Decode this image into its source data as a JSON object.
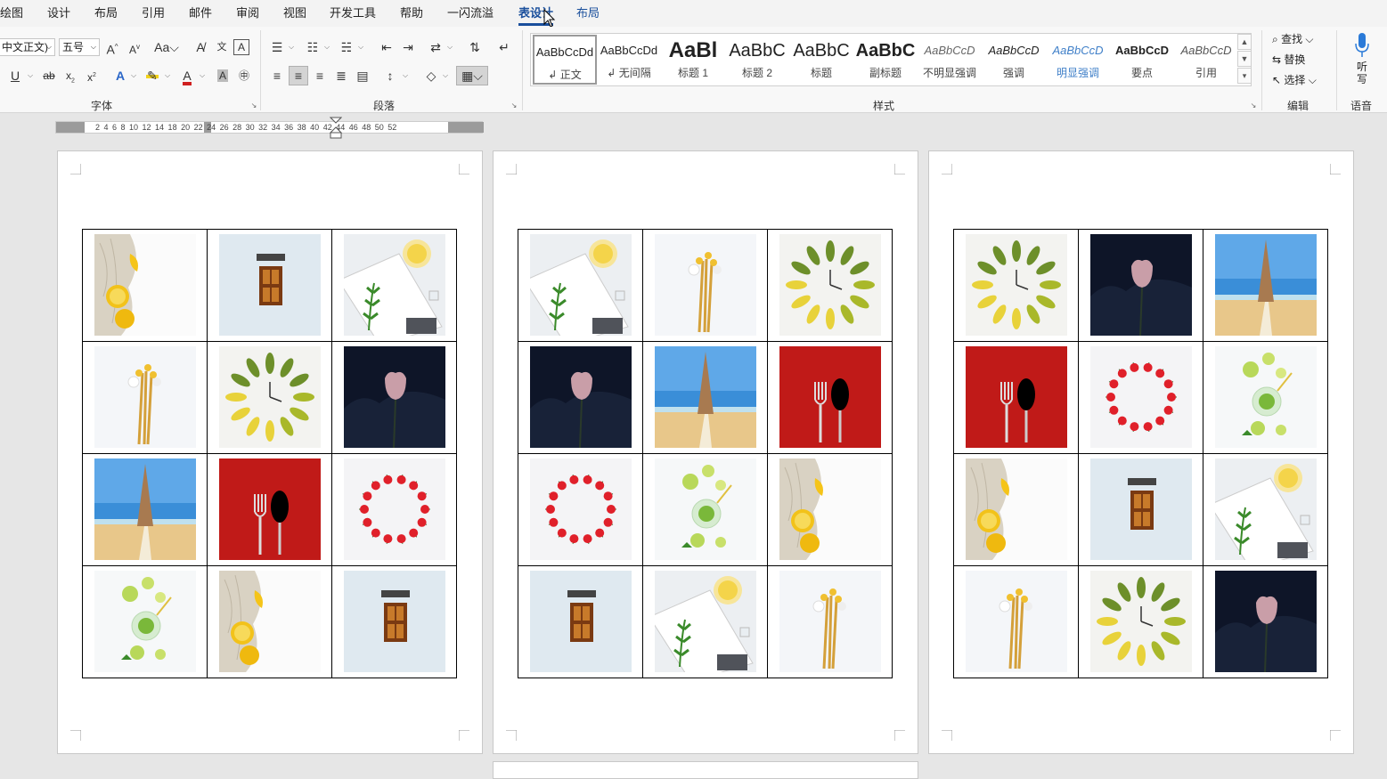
{
  "tabs": [
    "绘图",
    "设计",
    "布局",
    "引用",
    "邮件",
    "审阅",
    "视图",
    "开发工具",
    "帮助",
    "一闪流溢",
    "表设计",
    "布局"
  ],
  "active_tab": "表设计",
  "font_group": {
    "font_name": "中文正文)",
    "font_size": "五号",
    "label": "字体"
  },
  "paragraph_group": {
    "label": "段落"
  },
  "styles_group": {
    "label": "样式",
    "items": [
      {
        "preview": "AaBbCcDd",
        "name": "正文"
      },
      {
        "preview": "AaBbCcDd",
        "name": "无间隔"
      },
      {
        "preview": "AaBl",
        "name": "标题 1"
      },
      {
        "preview": "AaBbC",
        "name": "标题 2"
      },
      {
        "preview": "AaBbC",
        "name": "标题"
      },
      {
        "preview": "AaBbC",
        "name": "副标题"
      },
      {
        "preview": "AaBbCcD",
        "name": "不明显强调"
      },
      {
        "preview": "AaBbCcD",
        "name": "强调"
      },
      {
        "preview": "AaBbCcD",
        "name": "明显强调"
      },
      {
        "preview": "AaBbCcD",
        "name": "要点"
      },
      {
        "preview": "AaBbCcD",
        "name": "引用"
      }
    ]
  },
  "editing_group": {
    "find": "查找",
    "replace": "替换",
    "select": "选择",
    "label": "编辑"
  },
  "voice_group": {
    "dictate": "听写",
    "label": "语音"
  },
  "ruler": {
    "numbers": "2 4 6 8 10 12 14 18 20 22 24 26 28 30 32 34 36 38 40 42 44 46 48 50 52"
  },
  "pages": [
    {
      "cells": [
        "fabric-lemon",
        "window",
        "notebook-lemon",
        "flowers",
        "leaf-clock",
        "night-tulip",
        "beach-tower",
        "fork-spoon",
        "cherry-ring",
        "lime-drink",
        "fabric-lemon",
        "window"
      ]
    },
    {
      "cells": [
        "notebook-lemon",
        "flowers",
        "leaf-clock",
        "night-tulip",
        "beach-tower",
        "fork-spoon",
        "cherry-ring",
        "lime-drink",
        "fabric-lemon",
        "window",
        "notebook-lemon",
        "flowers"
      ]
    },
    {
      "cells": [
        "leaf-clock",
        "night-tulip",
        "beach-tower",
        "fork-spoon",
        "cherry-ring",
        "lime-drink",
        "fabric-lemon",
        "window",
        "notebook-lemon",
        "flowers",
        "leaf-clock",
        "night-tulip"
      ]
    }
  ],
  "colors": {
    "accent": "#1a4f9c",
    "cherry": "#e0202a",
    "fork_bg": "#c01a18",
    "night": "#0e1528",
    "sky": "#3a8ed8",
    "sand": "#e8c78a"
  }
}
